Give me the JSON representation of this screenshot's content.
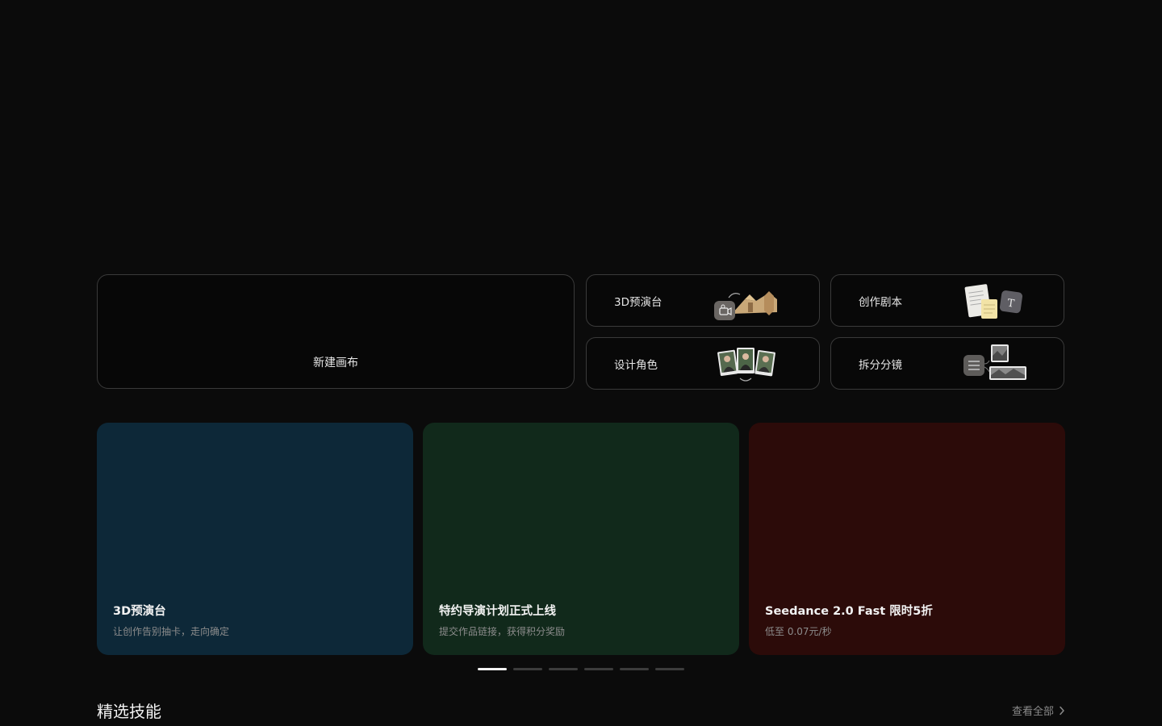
{
  "quick_actions": {
    "new_canvas": "新建画布",
    "tools": [
      {
        "label": "3D预演台",
        "icon": "3d-stage-thumbnail"
      },
      {
        "label": "创作剧本",
        "icon": "script-documents-thumbnail"
      },
      {
        "label": "设计角色",
        "icon": "character-photos-thumbnail"
      },
      {
        "label": "拆分分镜",
        "icon": "storyboard-split-thumbnail"
      }
    ]
  },
  "banners": [
    {
      "title": "3D预演台",
      "subtitle": "让创作告别抽卡，走向确定",
      "color": "#0d2838"
    },
    {
      "title": "特约导演计划正式上线",
      "subtitle": "提交作品链接，获得积分奖励",
      "color": "#11291b"
    },
    {
      "title": "Seedance 2.0 Fast 限时5折",
      "subtitle": "低至 0.07元/秒",
      "color": "#2c0b09"
    }
  ],
  "carousel": {
    "count": 6,
    "active_index": 0
  },
  "featured_skills": {
    "title": "精选技能",
    "view_all": "查看全部"
  }
}
